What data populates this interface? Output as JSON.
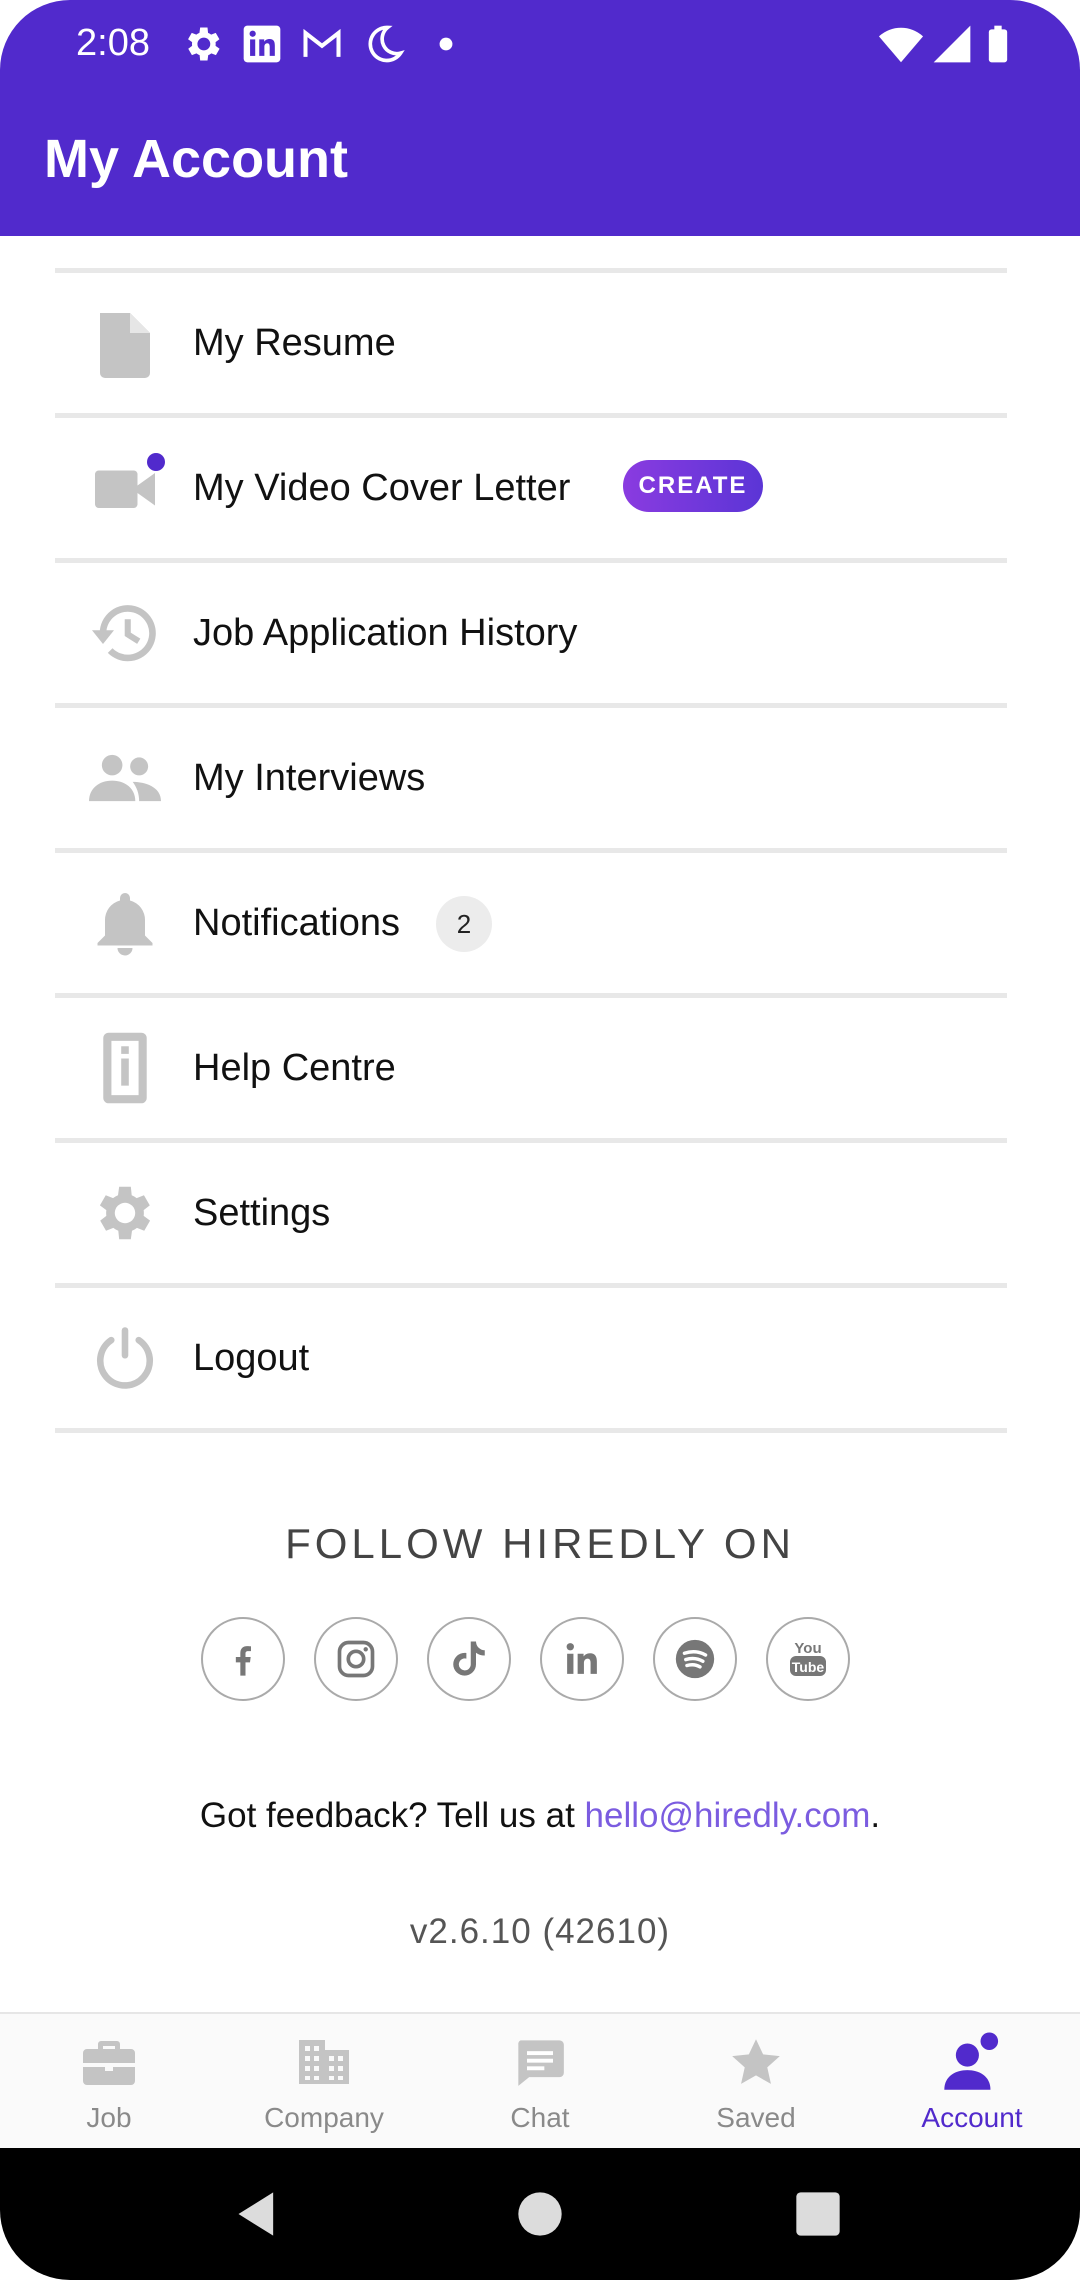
{
  "status_bar": {
    "time": "2:08",
    "icons": [
      "settings-gear-icon",
      "linkedin-icon",
      "gmail-icon",
      "do-not-disturb-moon-icon",
      "dot-icon"
    ],
    "right_icons": [
      "wifi-icon",
      "signal-icon",
      "battery-icon"
    ]
  },
  "header": {
    "title": "My Account",
    "color": "#512acc"
  },
  "menu": {
    "items": [
      {
        "label": "My Resume",
        "icon": "document-icon"
      },
      {
        "label": "My Video Cover Letter",
        "icon": "video-camera-icon",
        "badge": "CREATE"
      },
      {
        "label": "Job Application History",
        "icon": "history-icon"
      },
      {
        "label": "My Interviews",
        "icon": "people-icon"
      },
      {
        "label": "Notifications",
        "icon": "bell-icon",
        "count": "2"
      },
      {
        "label": "Help Centre",
        "icon": "info-icon"
      },
      {
        "label": "Settings",
        "icon": "gear-icon"
      },
      {
        "label": "Logout",
        "icon": "power-icon"
      }
    ]
  },
  "follow": {
    "title": "FOLLOW HIREDLY ON",
    "socials": [
      "facebook-icon",
      "instagram-icon",
      "tiktok-icon",
      "linkedin-icon",
      "spotify-icon",
      "youtube-icon"
    ]
  },
  "feedback": {
    "prefix": "Got feedback? Tell us at ",
    "email": "hello@hiredly.com",
    "suffix": "."
  },
  "version": "v2.6.10 (42610)",
  "bottom_nav": {
    "items": [
      {
        "label": "Job",
        "icon": "briefcase-icon"
      },
      {
        "label": "Company",
        "icon": "building-icon"
      },
      {
        "label": "Chat",
        "icon": "chat-icon"
      },
      {
        "label": "Saved",
        "icon": "star-icon"
      },
      {
        "label": "Account",
        "icon": "account-icon",
        "active": true
      }
    ],
    "active_color": "#512acc"
  }
}
